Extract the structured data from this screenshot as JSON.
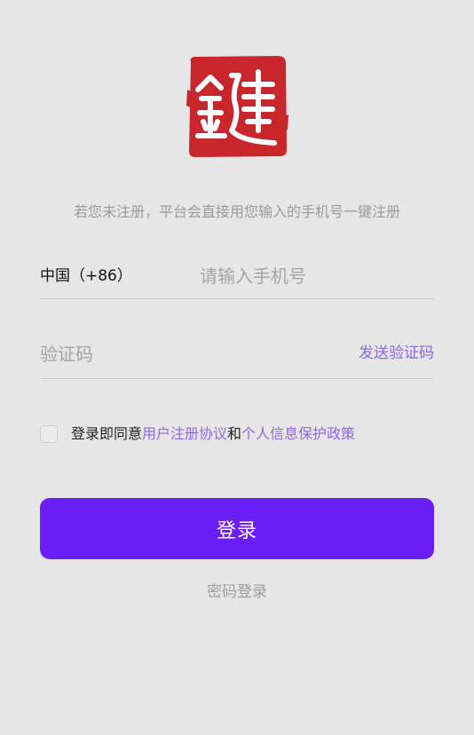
{
  "logo": {
    "glyph": "鍵",
    "color": "#c8262b"
  },
  "hint": "若您未注册，平台会直接用您输入的手机号一键注册",
  "phone": {
    "country_code": "中国（+86）",
    "placeholder": "请输入手机号",
    "value": ""
  },
  "code": {
    "placeholder": "验证码",
    "value": "",
    "send_label": "发送验证码"
  },
  "agreement": {
    "checked": false,
    "prefix": "登录即同意",
    "user_agreement": "用户注册协议",
    "conjunction": "和",
    "privacy_policy": "个人信息保护政策"
  },
  "login_button": "登录",
  "password_login": "密码登录",
  "colors": {
    "background": "#e6e6e7",
    "accent": "#6b1ff8",
    "link": "#8f68e6",
    "hint_text": "#9a9a9a"
  }
}
